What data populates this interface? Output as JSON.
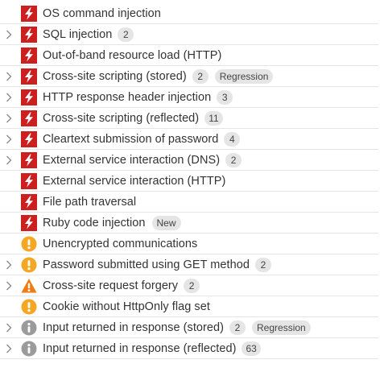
{
  "colors": {
    "high": "#cc1f1f",
    "medium": "#f5a623",
    "low": "#f07b12",
    "info": "#9b9b9b",
    "badge_bg": "#e5e5e5"
  },
  "issues": [
    {
      "name": "OS command injection",
      "severity": "high",
      "icon": "lightning-icon",
      "expandable": false,
      "count": "",
      "tag": ""
    },
    {
      "name": "SQL injection",
      "severity": "high",
      "icon": "lightning-icon",
      "expandable": true,
      "count": "2",
      "tag": ""
    },
    {
      "name": "Out-of-band resource load (HTTP)",
      "severity": "high",
      "icon": "lightning-icon",
      "expandable": false,
      "count": "",
      "tag": ""
    },
    {
      "name": "Cross-site scripting (stored)",
      "severity": "high",
      "icon": "lightning-icon",
      "expandable": true,
      "count": "2",
      "tag": "Regression"
    },
    {
      "name": "HTTP response header injection",
      "severity": "high",
      "icon": "lightning-icon",
      "expandable": true,
      "count": "3",
      "tag": ""
    },
    {
      "name": "Cross-site scripting (reflected)",
      "severity": "high",
      "icon": "lightning-icon",
      "expandable": true,
      "count": "11",
      "tag": ""
    },
    {
      "name": "Cleartext submission of password",
      "severity": "high",
      "icon": "lightning-icon",
      "expandable": true,
      "count": "4",
      "tag": ""
    },
    {
      "name": "External service interaction (DNS)",
      "severity": "high",
      "icon": "lightning-icon",
      "expandable": true,
      "count": "2",
      "tag": ""
    },
    {
      "name": "External service interaction (HTTP)",
      "severity": "high",
      "icon": "lightning-icon",
      "expandable": false,
      "count": "",
      "tag": ""
    },
    {
      "name": "File path traversal",
      "severity": "high",
      "icon": "lightning-icon",
      "expandable": false,
      "count": "",
      "tag": ""
    },
    {
      "name": "Ruby code injection",
      "severity": "high",
      "icon": "lightning-icon",
      "expandable": false,
      "count": "",
      "tag": "New"
    },
    {
      "name": "Unencrypted communications",
      "severity": "medium",
      "icon": "exclamation-circle-icon",
      "expandable": false,
      "count": "",
      "tag": ""
    },
    {
      "name": "Password submitted using GET method",
      "severity": "medium",
      "icon": "exclamation-circle-icon",
      "expandable": true,
      "count": "2",
      "tag": ""
    },
    {
      "name": "Cross-site request forgery",
      "severity": "low",
      "icon": "warning-triangle-icon",
      "expandable": true,
      "count": "2",
      "tag": ""
    },
    {
      "name": "Cookie without HttpOnly flag set",
      "severity": "medium",
      "icon": "exclamation-circle-icon",
      "expandable": false,
      "count": "",
      "tag": ""
    },
    {
      "name": "Input returned in response (stored)",
      "severity": "info",
      "icon": "info-circle-icon",
      "expandable": true,
      "count": "2",
      "tag": "Regression"
    },
    {
      "name": "Input returned in response (reflected)",
      "severity": "info",
      "icon": "info-circle-icon",
      "expandable": true,
      "count": "63",
      "tag": ""
    }
  ]
}
